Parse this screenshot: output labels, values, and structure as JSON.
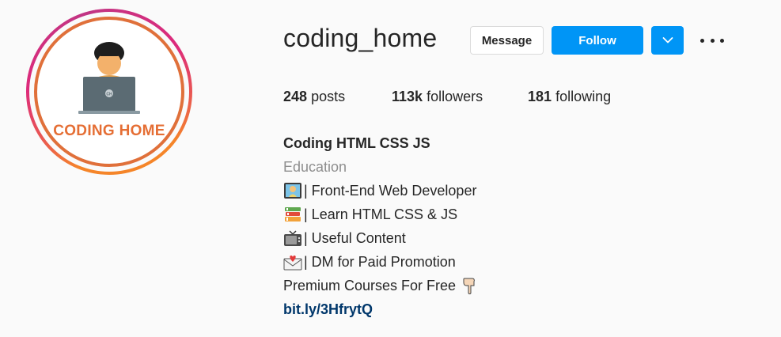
{
  "profile": {
    "avatar_text": "CODING HOME",
    "username": "coding_home",
    "actions": {
      "message_label": "Message",
      "follow_label": "Follow"
    },
    "stats": {
      "posts_count": "248",
      "posts_label": "posts",
      "followers_count": "113k",
      "followers_label": "followers",
      "following_count": "181",
      "following_label": "following"
    },
    "bio": {
      "name": "Coding HTML CSS JS",
      "category": "Education",
      "lines": [
        {
          "icon": "developer-emoji-icon",
          "text": "| Front-End Web Developer"
        },
        {
          "icon": "books-emoji-icon",
          "text": "| Learn HTML CSS & JS"
        },
        {
          "icon": "tv-emoji-icon",
          "text": "| Useful Content"
        },
        {
          "icon": "envelope-heart-emoji-icon",
          "text": "| DM for Paid Promotion"
        }
      ],
      "promo_text": "Premium Courses For Free",
      "promo_icon": "pointing-down-emoji-icon",
      "link": "bit.ly/3HfrytQ"
    }
  },
  "colors": {
    "accent_blue": "#0095f6",
    "link_blue": "#00376b",
    "brand_orange": "#e56e34",
    "muted_gray": "#8e8e8e"
  }
}
